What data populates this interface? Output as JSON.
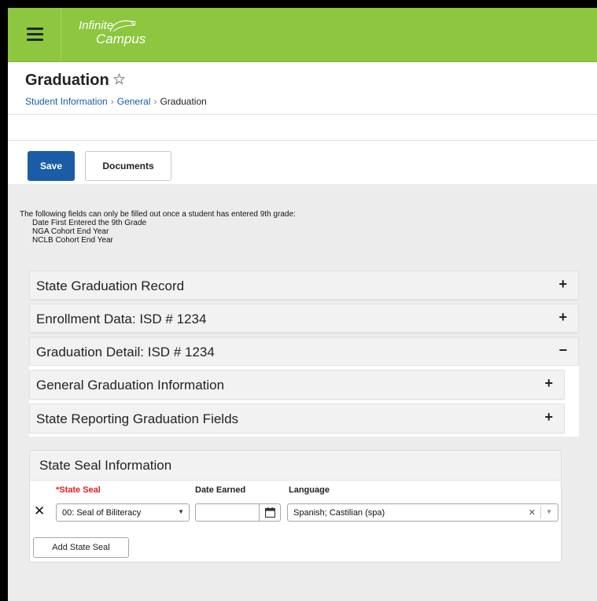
{
  "app": {
    "logo_line1": "Infinite",
    "logo_line2": "Campus",
    "brand_color": "#8dc63f",
    "primary_color": "#1a5da6"
  },
  "header": {
    "title": "Graduation",
    "favorite_icon": "star-outline-icon",
    "breadcrumb": [
      {
        "label": "Student Information"
      },
      {
        "label": "General"
      },
      {
        "label": "Graduation"
      }
    ]
  },
  "toolbar": {
    "save_label": "Save",
    "documents_label": "Documents"
  },
  "note": {
    "intro": "The following fields can only be filled out once a student has entered 9th grade:",
    "items": [
      "Date First Entered the 9th Grade",
      "NGA Cohort End Year",
      "NCLB Cohort End Year"
    ]
  },
  "sections": [
    {
      "title": "State Graduation Record",
      "toggle": "+"
    },
    {
      "title": "Enrollment Data: ISD # 1234",
      "toggle": "+"
    },
    {
      "title": "Graduation Detail: ISD # 1234",
      "toggle": "−"
    }
  ],
  "subsections": [
    {
      "title": "General Graduation Information",
      "toggle": "+"
    },
    {
      "title": "State Reporting Graduation Fields",
      "toggle": "+"
    }
  ],
  "state_seal": {
    "title": "State Seal Information",
    "columns": {
      "seal": "*State Seal",
      "date": "Date Earned",
      "language": "Language"
    },
    "row": {
      "seal_value": "00: Seal of Biliteracy",
      "date_value": "",
      "language_value": "Spanish; Castilian (spa)"
    },
    "add_label": "Add State Seal"
  }
}
